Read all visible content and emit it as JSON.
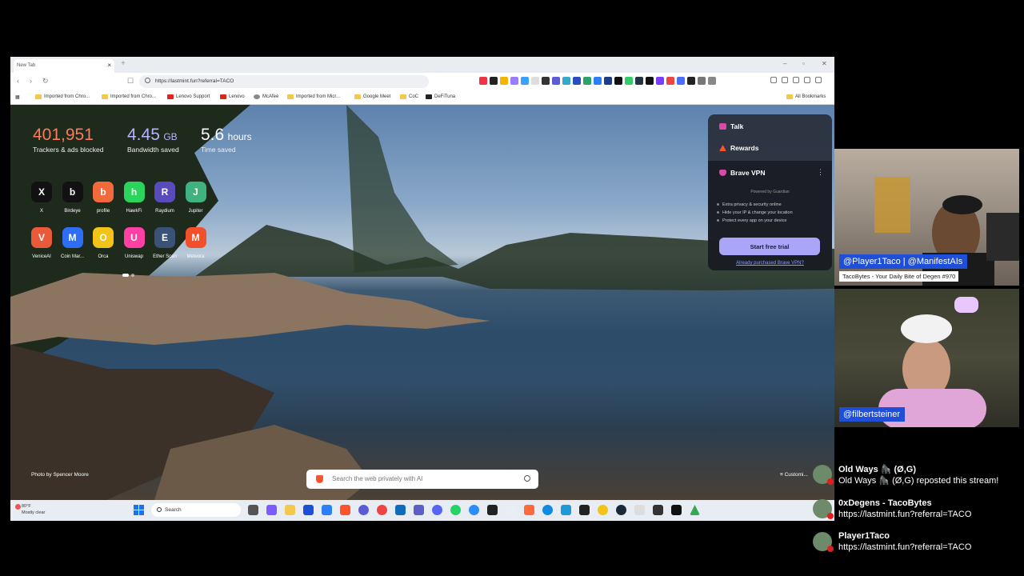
{
  "browser": {
    "tab_title": "New Tab",
    "url": "https://lastmint.fun?referral=TACO",
    "bookmarks": [
      {
        "label": "Imported from Chro...",
        "kind": "folder"
      },
      {
        "label": "Imported from Chro...",
        "kind": "folder"
      },
      {
        "label": "Lenovo Support",
        "kind": "lenovo"
      },
      {
        "label": "Lenovo",
        "kind": "lenovo"
      },
      {
        "label": "McAfee",
        "kind": "mcafee"
      },
      {
        "label": "Imported from Micr...",
        "kind": "folder"
      },
      {
        "label": "Google Meet",
        "kind": "folder"
      },
      {
        "label": "CoC",
        "kind": "folder"
      },
      {
        "label": "DeFiTuna",
        "kind": "site"
      }
    ],
    "all_bookmarks": "All Bookmarks"
  },
  "ntp": {
    "stats": [
      {
        "value": "401,951",
        "unit": "",
        "label": "Trackers & ads blocked",
        "color": "#ff7a5c"
      },
      {
        "value": "4.45",
        "unit": "GB",
        "label": "Bandwidth saved",
        "color": "#b7b4ff"
      },
      {
        "value": "5.6",
        "unit": "hours",
        "label": "Time saved",
        "color": "#ffffff"
      }
    ],
    "shortcuts_row1": [
      {
        "name": "X",
        "glyph": "X",
        "color": "#111111"
      },
      {
        "name": "Birdeye",
        "glyph": "b",
        "color": "#111111"
      },
      {
        "name": "profile",
        "glyph": "b",
        "color": "#f06a3c"
      },
      {
        "name": "HawkFi",
        "glyph": "h",
        "color": "#2bd45a"
      },
      {
        "name": "Raydium",
        "glyph": "R",
        "color": "#5a4bbd"
      },
      {
        "name": "Jupiter",
        "glyph": "J",
        "color": "#3fb27f"
      }
    ],
    "shortcuts_row2": [
      {
        "name": "VeniceAI",
        "glyph": "V",
        "color": "#e85a3a"
      },
      {
        "name": "Coin Mar...",
        "glyph": "M",
        "color": "#2d6ef5"
      },
      {
        "name": "Orca",
        "glyph": "O",
        "color": "#f2c318"
      },
      {
        "name": "Uniswap",
        "glyph": "U",
        "color": "#ff3fa4"
      },
      {
        "name": "Ether Scan",
        "glyph": "E",
        "color": "#3a5278"
      },
      {
        "name": "Meteora",
        "glyph": "M",
        "color": "#f2502a"
      }
    ],
    "panel": {
      "talk": "Talk",
      "rewards": "Rewards",
      "vpn_title": "Brave VPN",
      "powered": "Powered by Guardian",
      "features": [
        "Extra privacy & security online",
        "Hide your IP & change your location",
        "Protect every app on your device"
      ],
      "cta": "Start free trial",
      "already": "Already purchased Brave VPN?"
    },
    "photo_credit": "Photo by Spencer Moore",
    "customize": "Customi...",
    "search_placeholder": "Search the web privately with AI"
  },
  "taskbar": {
    "temp": "80°F",
    "weather": "Mostly clear",
    "search": "Search"
  },
  "stream": {
    "cam1_names": "@Player1Taco | @ManifestAIs",
    "cam1_sub": "TacoBytes - Your Daily Bite of Degen #970",
    "cam2_name": "@filbertsteiner"
  },
  "chat": [
    {
      "name": "Old Ways 🦍 (Ø,G)",
      "message": "Old Ways 🦍 (Ø,G) reposted this stream!"
    },
    {
      "name": "0xDegens - TacoBytes",
      "message": "https://lastmint.fun?referral=TACO"
    },
    {
      "name": "Player1Taco",
      "message": "https://lastmint.fun?referral=TACO"
    }
  ]
}
